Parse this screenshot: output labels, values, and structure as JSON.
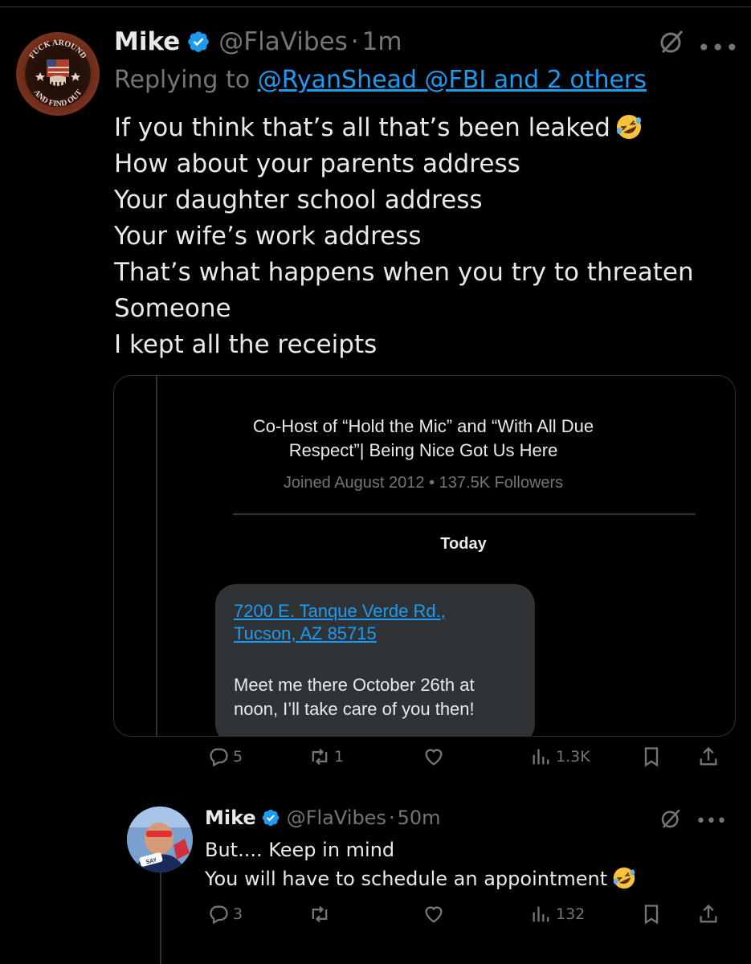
{
  "tweet": {
    "name": "Mike",
    "handle": "@FlaVibes",
    "separator": "·",
    "time": "1m",
    "replying_label": "Replying to",
    "replying_targets": "@RyanShead @FBI and 2 others",
    "lines": [
      "If you think that’s all that’s been leaked",
      "How about your parents address",
      "Your daughter school address",
      "Your wife’s work address",
      "That’s what happens when you try to threaten",
      "Someone",
      "I kept all the receipts"
    ],
    "avatar_text": [
      "FUCK AROUND",
      "AND FIND OUT"
    ]
  },
  "media": {
    "bio": "Co-Host of “Hold the Mic” and “With All Due Respect”| Being Nice Got Us Here",
    "joined": "Joined August 2012 • 137.5K Followers",
    "divider_label": "Today",
    "dm_address_line1": "7200 E. Tanque Verde Rd.,",
    "dm_address_line2": "Tucson, AZ 85715",
    "dm_message_line1": "Meet me there October 26th at",
    "dm_message_line2": "noon, I’ll take care of you then!"
  },
  "actions_main": {
    "replies": "5",
    "reposts": "1",
    "likes": "",
    "views": "1.3K"
  },
  "reply": {
    "name": "Mike",
    "handle": "@FlaVibes",
    "separator": "·",
    "time": "50m",
    "lines": [
      "But.... Keep in mind",
      "You will have to schedule an appointment"
    ],
    "avatar_text": "SAY"
  },
  "actions_reply": {
    "replies": "3",
    "reposts": "",
    "likes": "",
    "views": "132"
  },
  "colors": {
    "background": "#000000",
    "text": "#e7e9ea",
    "secondary": "#71767b",
    "accent": "#1d9bf0",
    "border": "#2f3336"
  },
  "icons": [
    "verified-badge-icon",
    "grok-icon",
    "more-icon",
    "reply-icon",
    "repost-icon",
    "like-icon",
    "views-icon",
    "bookmark-icon",
    "share-icon",
    "rofl-emoji"
  ]
}
